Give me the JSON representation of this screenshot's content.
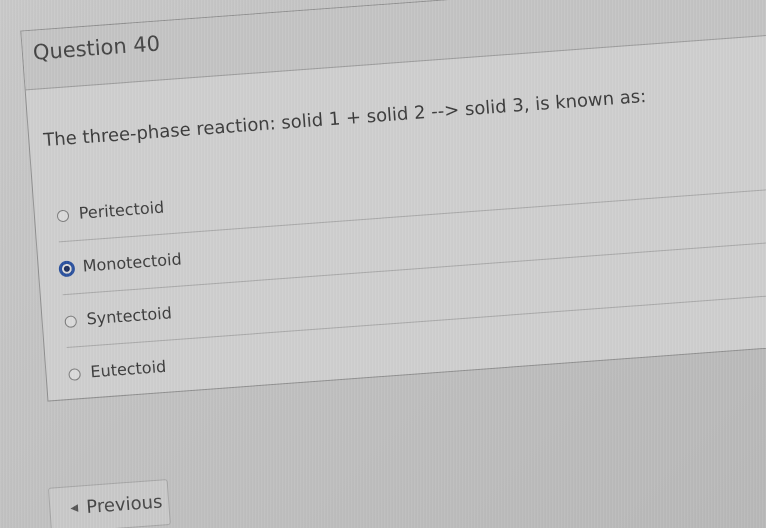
{
  "question": {
    "title": "Question 40",
    "text": "The three-phase reaction: solid 1 + solid 2 --> solid 3, is known as:"
  },
  "answers": [
    {
      "label": "Peritectoid",
      "selected": false
    },
    {
      "label": "Monotectoid",
      "selected": true
    },
    {
      "label": "Syntectoid",
      "selected": false
    },
    {
      "label": "Eutectoid",
      "selected": false
    }
  ],
  "navigation": {
    "previous_label": "Previous",
    "previous_icon": "chevron-left-icon"
  },
  "colors": {
    "selected_radio": "#29509e",
    "background": "#c4c4c4"
  }
}
